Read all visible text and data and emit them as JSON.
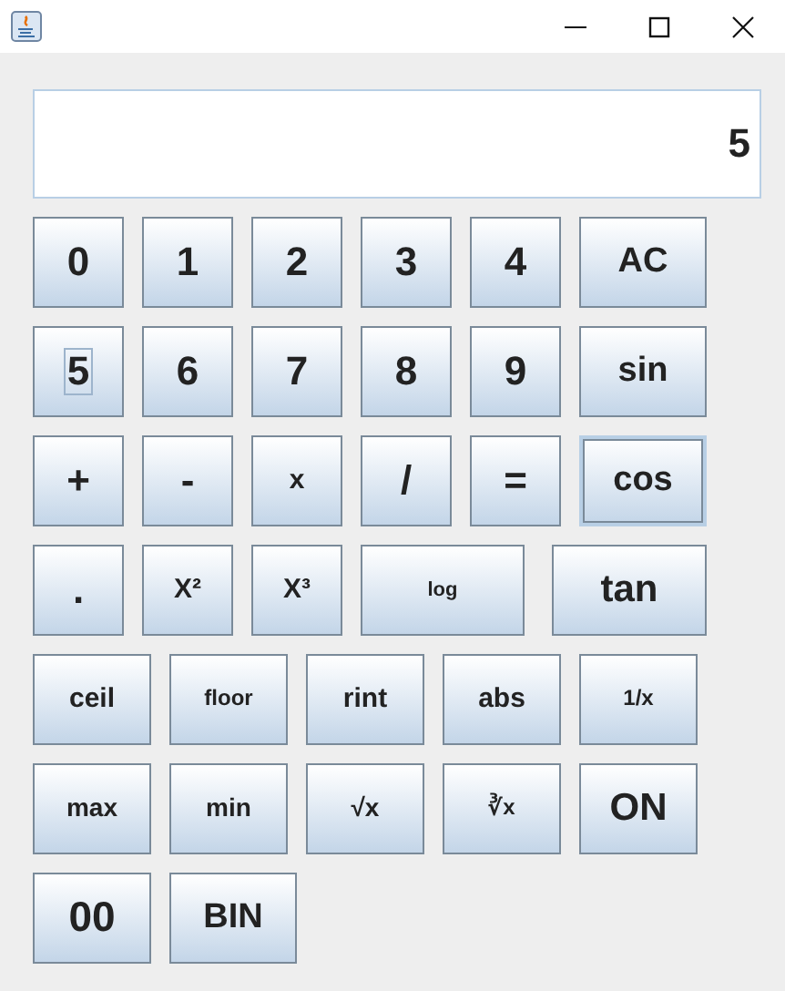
{
  "display": {
    "value": "5"
  },
  "keypad": [
    [
      {
        "label": "0",
        "focused": false,
        "highlighted": false
      },
      {
        "label": "1",
        "focused": false,
        "highlighted": false
      },
      {
        "label": "2",
        "focused": false,
        "highlighted": false
      },
      {
        "label": "3",
        "focused": false,
        "highlighted": false
      },
      {
        "label": "4",
        "focused": false,
        "highlighted": false
      },
      {
        "label": "AC",
        "focused": false,
        "highlighted": false
      }
    ],
    [
      {
        "label": "5",
        "focused": true,
        "highlighted": false
      },
      {
        "label": "6",
        "focused": false,
        "highlighted": false
      },
      {
        "label": "7",
        "focused": false,
        "highlighted": false
      },
      {
        "label": "8",
        "focused": false,
        "highlighted": false
      },
      {
        "label": "9",
        "focused": false,
        "highlighted": false
      },
      {
        "label": "sin",
        "focused": false,
        "highlighted": false
      }
    ],
    [
      {
        "label": "+",
        "focused": false,
        "highlighted": false
      },
      {
        "label": "-",
        "focused": false,
        "highlighted": false
      },
      {
        "label": "x",
        "focused": false,
        "highlighted": false
      },
      {
        "label": "/",
        "focused": false,
        "highlighted": false
      },
      {
        "label": "=",
        "focused": false,
        "highlighted": false
      },
      {
        "label": "cos",
        "focused": false,
        "highlighted": true
      }
    ],
    [
      {
        "label": ".",
        "focused": false,
        "highlighted": false
      },
      {
        "label": "X²",
        "focused": false,
        "highlighted": false
      },
      {
        "label": "X³",
        "focused": false,
        "highlighted": false
      },
      {
        "label": "log",
        "focused": false,
        "highlighted": false
      },
      {
        "label": "tan",
        "focused": false,
        "highlighted": false
      }
    ],
    [
      {
        "label": "ceil",
        "focused": false,
        "highlighted": false
      },
      {
        "label": "floor",
        "focused": false,
        "highlighted": false
      },
      {
        "label": "rint",
        "focused": false,
        "highlighted": false
      },
      {
        "label": "abs",
        "focused": false,
        "highlighted": false
      },
      {
        "label": "1/x",
        "focused": false,
        "highlighted": false
      }
    ],
    [
      {
        "label": "max",
        "focused": false,
        "highlighted": false
      },
      {
        "label": "min",
        "focused": false,
        "highlighted": false
      },
      {
        "label": "√x",
        "focused": false,
        "highlighted": false
      },
      {
        "label": "∛x",
        "focused": false,
        "highlighted": false
      },
      {
        "label": "ON",
        "focused": false,
        "highlighted": false
      }
    ],
    [
      {
        "label": "00",
        "focused": false,
        "highlighted": false
      },
      {
        "label": "BIN",
        "focused": false,
        "highlighted": false
      }
    ]
  ]
}
